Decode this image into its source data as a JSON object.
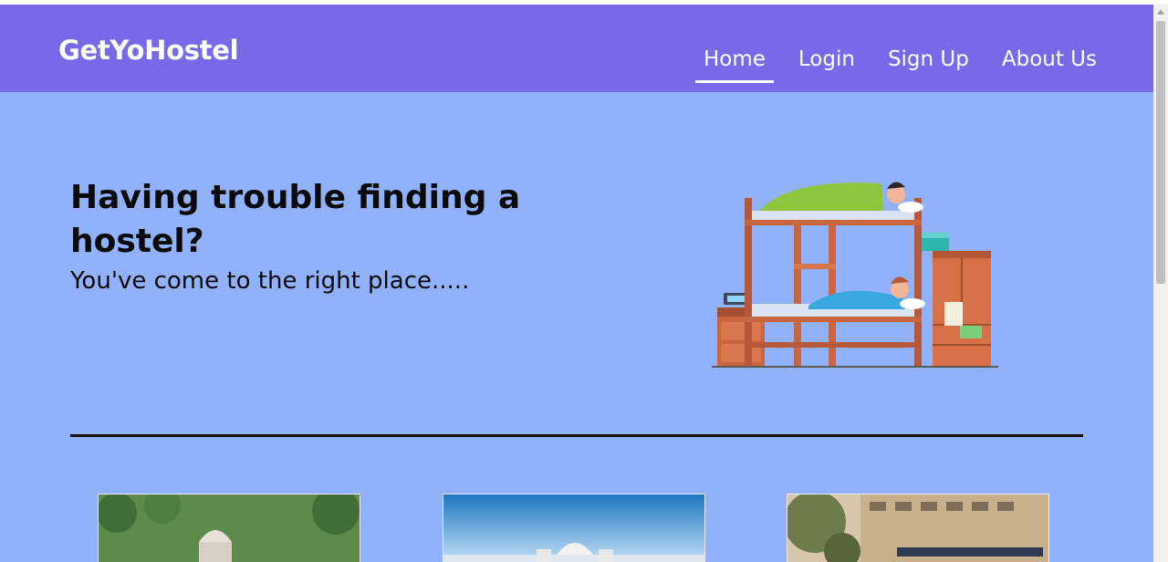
{
  "brand": "GetYoHostel",
  "nav": [
    {
      "label": "Home",
      "active": true
    },
    {
      "label": "Login",
      "active": false
    },
    {
      "label": "Sign Up",
      "active": false
    },
    {
      "label": "About Us",
      "active": false
    }
  ],
  "hero": {
    "title": "Having trouble finding a hostel?",
    "subtitle": "You've come to the right place.....",
    "illustration": "bunk-bed-illustration"
  },
  "cards": [
    {
      "image": "hostel-photo-1"
    },
    {
      "image": "hostel-photo-2"
    },
    {
      "image": "hostel-photo-3"
    }
  ],
  "colors": {
    "navbar": "#7968e8",
    "background": "#91b2fb",
    "text": "#0a0a0a"
  }
}
